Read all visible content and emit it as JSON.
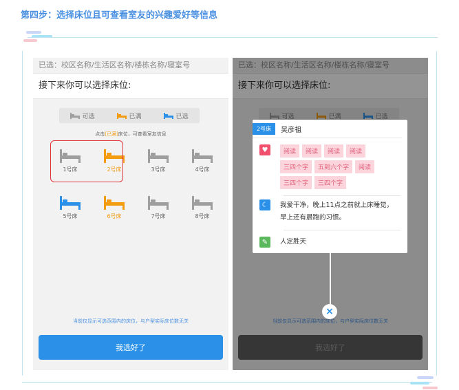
{
  "step_title": "第四步：选择床位且可查看室友的兴趣爱好等信息",
  "selected_text": "已选：校区名称/生活区名称/楼栋名称/寝室号",
  "prompt_text": "接下来你可以选择床位:",
  "legend": [
    {
      "label": "可选",
      "color": "#9e9e9e"
    },
    {
      "label": "已满",
      "color": "#f39c12"
    },
    {
      "label": "已选",
      "color": "#2b91e8"
    }
  ],
  "hint": {
    "prefix": "点击",
    "highlight": "[已满]",
    "suffix": "床位，可查看室友信息"
  },
  "beds": [
    {
      "label": "1号床",
      "state": "available",
      "color": "#9e9e9e"
    },
    {
      "label": "2号床",
      "state": "full",
      "color": "#f39c12"
    },
    {
      "label": "3号床",
      "state": "available",
      "color": "#9e9e9e"
    },
    {
      "label": "4号床",
      "state": "available",
      "color": "#9e9e9e"
    },
    {
      "label": "5号床",
      "state": "selected",
      "color": "#2b91e8"
    },
    {
      "label": "6号床",
      "state": "full",
      "color": "#f39c12"
    },
    {
      "label": "7号床",
      "state": "available",
      "color": "#9e9e9e"
    },
    {
      "label": "8号床",
      "state": "available",
      "color": "#9e9e9e"
    }
  ],
  "note": "当前仅显示可选范围内的床位，与户型实际床位数无关",
  "confirm_label": "我选好了",
  "popup": {
    "bed_tag": "2号床",
    "name": "吴彦祖",
    "hobbies": [
      "阅读",
      "阅读",
      "阅读",
      "阅读",
      "三四个字",
      "五到六个字",
      "阅读",
      "三四个字",
      "三四个字"
    ],
    "habit": "我爱干净，晚上11点之前就上床睡觉，早上还有晨跑的习惯。",
    "motto": "人定胜天",
    "close_symbol": "×",
    "icon_colors": {
      "hobby": "#f0506e",
      "habit": "#2b91e8",
      "motto": "#5cb85c"
    }
  }
}
